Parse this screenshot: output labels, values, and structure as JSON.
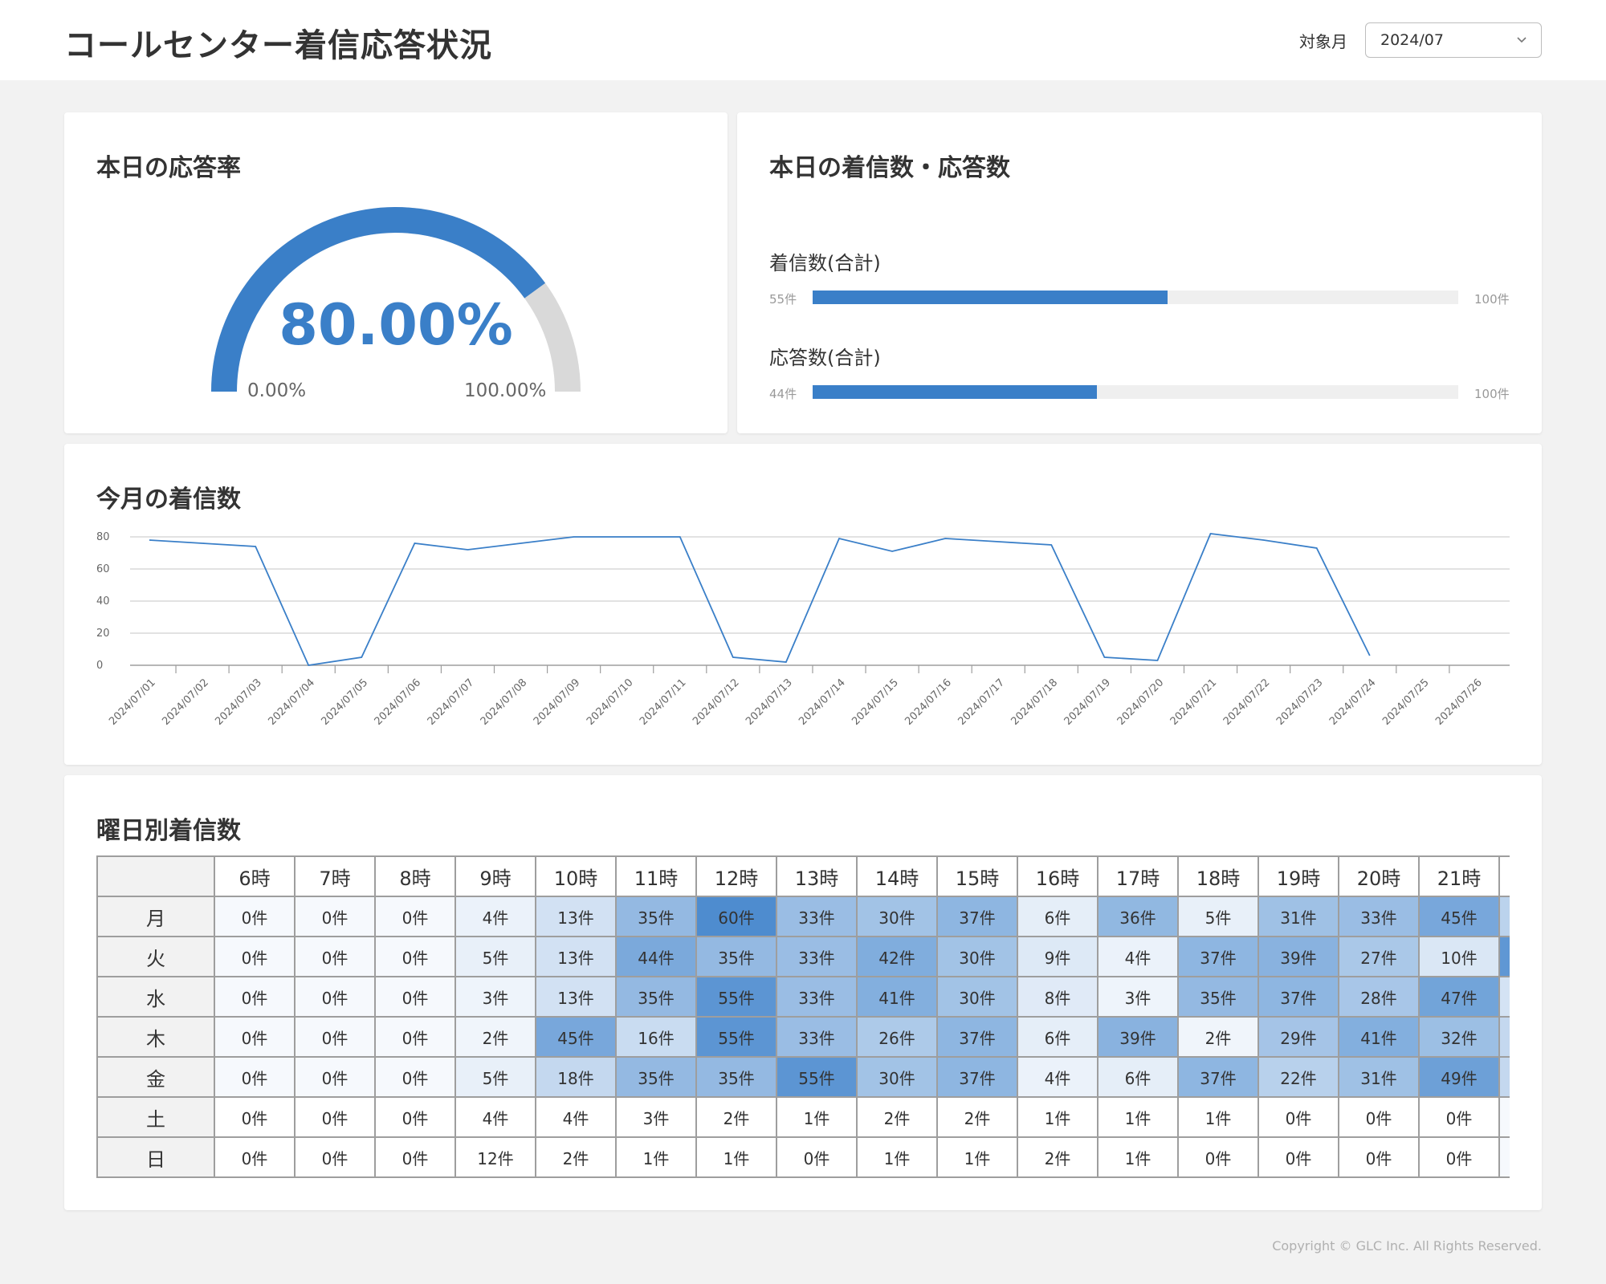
{
  "header": {
    "title": "コールセンター着信応答状況",
    "month_label": "対象月",
    "month_value": "2024/07"
  },
  "rate_card": {
    "title": "本日の応答率",
    "value_text": "80.00%",
    "value": 80,
    "min_label": "0.00%",
    "max_label": "100.00%",
    "color_fill": "#3a7fc8",
    "color_track": "#d9d9d9"
  },
  "calls_card": {
    "title": "本日の着信数・応答数",
    "bars": [
      {
        "label": "着信数(合計)",
        "value": 55,
        "max": 100,
        "min_text": "55件",
        "max_text": "100件"
      },
      {
        "label": "応答数(合計)",
        "value": 44,
        "max": 100,
        "min_text": "44件",
        "max_text": "100件"
      }
    ]
  },
  "month_card": {
    "title": "今月の着信数"
  },
  "chart_data": {
    "type": "line",
    "title": "今月の着信数",
    "x": [
      "2024/07/01",
      "2024/07/02",
      "2024/07/03",
      "2024/07/04",
      "2024/07/05",
      "2024/07/06",
      "2024/07/07",
      "2024/07/08",
      "2024/07/09",
      "2024/07/10",
      "2024/07/11",
      "2024/07/12",
      "2024/07/13",
      "2024/07/14",
      "2024/07/15",
      "2024/07/16",
      "2024/07/17",
      "2024/07/18",
      "2024/07/19",
      "2024/07/20",
      "2024/07/21",
      "2024/07/22",
      "2024/07/23",
      "2024/07/24",
      "2024/07/25",
      "2024/07/26"
    ],
    "series": [
      {
        "values": [
          78,
          76,
          74,
          0,
          5,
          76,
          72,
          76,
          80,
          80,
          80,
          5,
          2,
          79,
          71,
          79,
          77,
          75,
          5,
          3,
          82,
          78,
          73,
          6
        ]
      }
    ],
    "yticks": [
      0,
      20,
      40,
      60,
      80
    ],
    "ylim": [
      0,
      85
    ],
    "grid": true,
    "color": "#3a7fc8"
  },
  "heat_card": {
    "title": "曜日別着信数",
    "hours": [
      "6時",
      "7時",
      "8時",
      "9時",
      "10時",
      "11時",
      "12時",
      "13時",
      "14時",
      "15時",
      "16時",
      "17時",
      "18時",
      "19時",
      "20時",
      "21時",
      ""
    ],
    "rows": [
      {
        "day": "月",
        "cells": [
          "0件",
          "0件",
          "0件",
          "4件",
          "13件",
          "35件",
          "60件",
          "33件",
          "30件",
          "37件",
          "6件",
          "36件",
          "5件",
          "31件",
          "33件",
          "45件",
          ""
        ]
      },
      {
        "day": "火",
        "cells": [
          "0件",
          "0件",
          "0件",
          "5件",
          "13件",
          "44件",
          "35件",
          "33件",
          "42件",
          "30件",
          "9件",
          "4件",
          "37件",
          "39件",
          "27件",
          "10件",
          ""
        ]
      },
      {
        "day": "水",
        "cells": [
          "0件",
          "0件",
          "0件",
          "3件",
          "13件",
          "35件",
          "55件",
          "33件",
          "41件",
          "30件",
          "8件",
          "3件",
          "35件",
          "37件",
          "28件",
          "47件",
          ""
        ]
      },
      {
        "day": "木",
        "cells": [
          "0件",
          "0件",
          "0件",
          "2件",
          "45件",
          "16件",
          "55件",
          "33件",
          "26件",
          "37件",
          "6件",
          "39件",
          "2件",
          "29件",
          "41件",
          "32件",
          ""
        ]
      },
      {
        "day": "金",
        "cells": [
          "0件",
          "0件",
          "0件",
          "5件",
          "18件",
          "35件",
          "35件",
          "55件",
          "30件",
          "37件",
          "4件",
          "6件",
          "37件",
          "22件",
          "31件",
          "49件",
          ""
        ]
      },
      {
        "day": "土",
        "cells": [
          "0件",
          "0件",
          "0件",
          "4件",
          "4件",
          "3件",
          "2件",
          "1件",
          "2件",
          "2件",
          "1件",
          "1件",
          "1件",
          "0件",
          "0件",
          "0件",
          ""
        ]
      },
      {
        "day": "日",
        "cells": [
          "0件",
          "0件",
          "0件",
          "12件",
          "2件",
          "1件",
          "1件",
          "0件",
          "1件",
          "1件",
          "2件",
          "1件",
          "0件",
          "0件",
          "0件",
          "0件",
          ""
        ]
      }
    ],
    "cutoff_column_levels": [
      0.35,
      0.9,
      0.2,
      0.3,
      0.3,
      0.0,
      0.0
    ]
  },
  "footer": {
    "copyright": "Copyright ©  GLC Inc. All Rights Reserved."
  }
}
